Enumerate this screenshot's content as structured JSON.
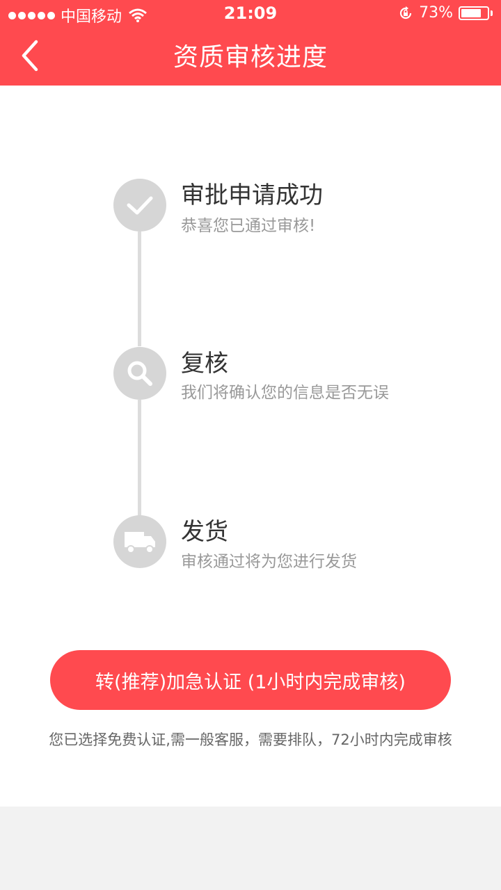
{
  "status_bar": {
    "carrier": "中国移动",
    "time": "21:09",
    "battery": "73%"
  },
  "header": {
    "title": "资质审核进度"
  },
  "steps": [
    {
      "title": "审批申请成功",
      "desc": "恭喜您已通过审核!",
      "icon": "check-icon"
    },
    {
      "title": "复核",
      "desc": "我们将确认您的信息是否无误",
      "icon": "search-icon"
    },
    {
      "title": "发货",
      "desc": "审核通过将为您进行发货",
      "icon": "truck-icon"
    }
  ],
  "cta": {
    "label": "转(推荐)加急认证 (1小时内完成审核)"
  },
  "note": "您已选择免费认证,需一般客服，需要排队，72小时内完成审核",
  "colors": {
    "accent": "#ff4a4f",
    "step_gray": "#d6d6d6"
  }
}
